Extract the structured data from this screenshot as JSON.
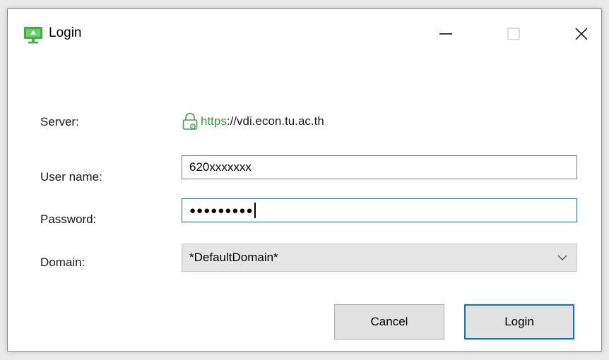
{
  "window": {
    "title": "Login",
    "app_icon": "monitor-icon",
    "controls": {
      "minimize_icon": "minimize-icon",
      "maximize_icon": "maximize-icon",
      "close_icon": "close-icon"
    }
  },
  "form": {
    "server": {
      "label": "Server:",
      "scheme": "https",
      "rest": "://vdi.econ.tu.ac.th",
      "icon": "lock-icon"
    },
    "username": {
      "label": "User name:",
      "value": "620xxxxxxx"
    },
    "password": {
      "label": "Password:",
      "masked_value": "●●●●●●●●●"
    },
    "domain": {
      "label": "Domain:",
      "selected": "*DefaultDomain*",
      "icon": "chevron-down-icon"
    }
  },
  "buttons": {
    "cancel": "Cancel",
    "login": "Login"
  },
  "colors": {
    "accent": "#0078d7",
    "secure": "#2e9c2e",
    "app_icon": "#3cb043"
  }
}
